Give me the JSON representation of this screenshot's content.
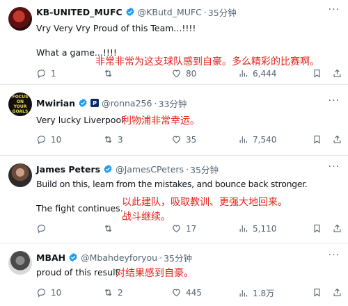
{
  "tweets": [
    {
      "name": "KB-UNITED_MUFC",
      "handle": "@KButd_MUFC",
      "dot": "·",
      "time": "35分钟",
      "line1": "Vry Very Vry Proud of this Team...!!!!",
      "line2": "What a game...!!!!",
      "translation": "非常非常为这支球队感到自豪。多么精彩的比赛啊。",
      "replies": "1",
      "retweets": "",
      "likes": "80",
      "views": "6,444"
    },
    {
      "name": "Mwirian",
      "badge": "P",
      "avatar_text": [
        "FOCUS",
        "ON",
        "YOUR",
        "GOALS"
      ],
      "handle": "@ronna256",
      "dot": "·",
      "time": "33分钟",
      "line1": "Very lucky Liverpool",
      "translation": "利物浦非常幸运。",
      "replies": "10",
      "retweets": "3",
      "likes": "35",
      "views": "7,540"
    },
    {
      "name": "James Peters",
      "handle": "@JamesCPeters",
      "dot": "·",
      "time": "35分钟",
      "line1": "Build on this, learn from the mistakes, and bounce back stronger.",
      "line2": "The fight continues.",
      "translation1": "以此建队，吸取教训、更强大地回来。",
      "translation2": "战斗继续。",
      "replies": "",
      "retweets": "",
      "likes": "17",
      "views": "5,110"
    },
    {
      "name": "MBAH",
      "handle": "@Mbahdeyforyou",
      "dot": "·",
      "time": "35分钟",
      "line1": "proud of this result",
      "translation": "对结果感到自豪。",
      "replies": "10",
      "retweets": "2",
      "likes": "445",
      "views": "1.8万"
    }
  ],
  "icons": {
    "verified": "verified-badge-icon",
    "more": "more-icon",
    "reply": "reply-icon",
    "retweet": "retweet-icon",
    "like": "like-icon",
    "views": "views-icon",
    "bookmark": "bookmark-icon",
    "share": "share-icon"
  },
  "more_label": "···",
  "colors": {
    "verified": "#1d9bf0",
    "translation": "#e0241b",
    "muted": "#536471"
  }
}
